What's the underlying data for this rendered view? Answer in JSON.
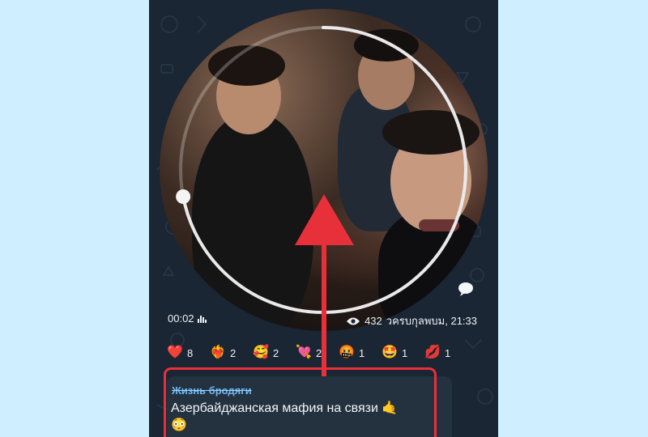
{
  "video": {
    "duration": "00:02",
    "views": "432",
    "timestamp": "วครบกุลพบม, 21:33",
    "progress": 0.72
  },
  "reactions": [
    {
      "emoji": "❤️",
      "icon": "heart-icon",
      "count": "8"
    },
    {
      "emoji": "❤️‍🔥",
      "icon": "heart-on-fire-icon",
      "count": "2"
    },
    {
      "emoji": "🥰",
      "icon": "smiling-face-hearts-icon",
      "count": "2"
    },
    {
      "emoji": "💘",
      "icon": "heart-arrow-icon",
      "count": "2"
    },
    {
      "emoji": "🤬",
      "icon": "angry-face-icon",
      "count": "1"
    },
    {
      "emoji": "🤩",
      "icon": "star-struck-icon",
      "count": "1"
    },
    {
      "emoji": "💋",
      "icon": "kiss-mark-icon",
      "count": "1"
    }
  ],
  "message": {
    "sender": "Жизнь бродяги",
    "text": "Азербайджанская мафия на связи",
    "emoji1": "🤙",
    "emoji2": "😳"
  },
  "colors": {
    "background": "#cfeeff",
    "chat": "#1a2634",
    "accent": "#e8303a",
    "sender": "#6fb7f0"
  }
}
